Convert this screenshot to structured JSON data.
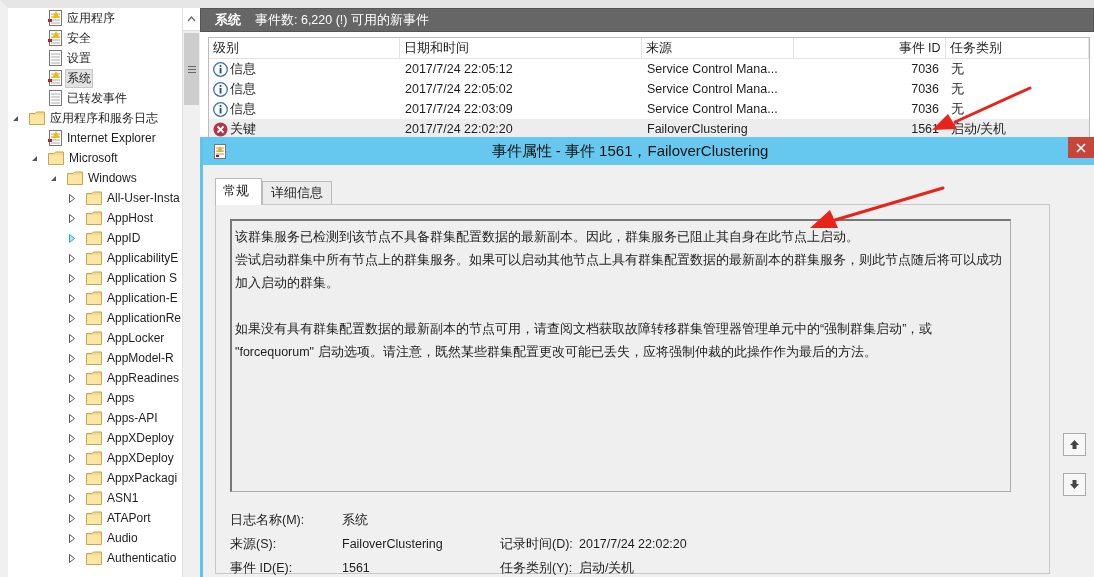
{
  "sidebar": {
    "visible_children": [
      {
        "label": "应用程序",
        "kind": "log-warn",
        "selected": false
      },
      {
        "label": "安全",
        "kind": "log-warn",
        "selected": false
      },
      {
        "label": "设置",
        "kind": "log",
        "selected": false
      },
      {
        "label": "系统",
        "kind": "log-warn",
        "selected": true
      },
      {
        "label": "已转发事件",
        "kind": "log",
        "selected": false
      }
    ],
    "items": [
      {
        "label": "应用程序和服务日志",
        "kind": "folder",
        "selected": false,
        "expanded": true,
        "hovered": false,
        "children": [
          {
            "label": "Internet Explorer",
            "kind": "log-warn",
            "selected": false
          },
          {
            "label": "Microsoft",
            "kind": "folder",
            "selected": false,
            "expanded": true,
            "hovered": false,
            "children": [
              {
                "label": "Windows",
                "kind": "folder",
                "selected": false,
                "expanded": true,
                "hovered": false,
                "children": [
                  {
                    "label": "All-User-Insta",
                    "kind": "folder",
                    "selected": false,
                    "expanded": false,
                    "hovered": false
                  },
                  {
                    "label": "AppHost",
                    "kind": "folder",
                    "selected": false,
                    "expanded": false,
                    "hovered": false
                  },
                  {
                    "label": "AppID",
                    "kind": "folder",
                    "selected": false,
                    "expanded": false,
                    "hovered": true
                  },
                  {
                    "label": "ApplicabilityE",
                    "kind": "folder",
                    "selected": false,
                    "expanded": false,
                    "hovered": false
                  },
                  {
                    "label": "Application S",
                    "kind": "folder",
                    "selected": false,
                    "expanded": false,
                    "hovered": false
                  },
                  {
                    "label": "Application-E",
                    "kind": "folder",
                    "selected": false,
                    "expanded": false,
                    "hovered": false
                  },
                  {
                    "label": "ApplicationRe",
                    "kind": "folder",
                    "selected": false,
                    "expanded": false,
                    "hovered": false
                  },
                  {
                    "label": "AppLocker",
                    "kind": "folder",
                    "selected": false,
                    "expanded": false,
                    "hovered": false
                  },
                  {
                    "label": "AppModel-R",
                    "kind": "folder",
                    "selected": false,
                    "expanded": false,
                    "hovered": false
                  },
                  {
                    "label": "AppReadines",
                    "kind": "folder",
                    "selected": false,
                    "expanded": false,
                    "hovered": false
                  },
                  {
                    "label": "Apps",
                    "kind": "folder",
                    "selected": false,
                    "expanded": false,
                    "hovered": false
                  },
                  {
                    "label": "Apps-API",
                    "kind": "folder",
                    "selected": false,
                    "expanded": false,
                    "hovered": false
                  },
                  {
                    "label": "AppXDeploy",
                    "kind": "folder",
                    "selected": false,
                    "expanded": false,
                    "hovered": false
                  },
                  {
                    "label": "AppXDeploy",
                    "kind": "folder",
                    "selected": false,
                    "expanded": false,
                    "hovered": false
                  },
                  {
                    "label": "AppxPackagi",
                    "kind": "folder",
                    "selected": false,
                    "expanded": false,
                    "hovered": false
                  },
                  {
                    "label": "ASN1",
                    "kind": "folder",
                    "selected": false,
                    "expanded": false,
                    "hovered": false
                  },
                  {
                    "label": "ATAPort",
                    "kind": "folder",
                    "selected": false,
                    "expanded": false,
                    "hovered": false
                  },
                  {
                    "label": "Audio",
                    "kind": "folder",
                    "selected": false,
                    "expanded": false,
                    "hovered": false
                  },
                  {
                    "label": "Authenticatio",
                    "kind": "folder",
                    "selected": false,
                    "expanded": false,
                    "hovered": false
                  }
                ]
              }
            ]
          }
        ]
      }
    ]
  },
  "log_header": {
    "title": "系统",
    "summary": "事件数: 6,220 (!) 可用的新事件"
  },
  "table": {
    "columns": [
      "级别",
      "日期和时间",
      "来源",
      "事件 ID",
      "任务类别"
    ],
    "rows": [
      {
        "kind": "info",
        "level": "信息",
        "date": "2017/7/24 22:05:12",
        "source": "Service Control Mana...",
        "event_id": "7036",
        "category": "无",
        "selected": false
      },
      {
        "kind": "info",
        "level": "信息",
        "date": "2017/7/24 22:05:02",
        "source": "Service Control Mana...",
        "event_id": "7036",
        "category": "无",
        "selected": false
      },
      {
        "kind": "info",
        "level": "信息",
        "date": "2017/7/24 22:03:09",
        "source": "Service Control Mana...",
        "event_id": "7036",
        "category": "无",
        "selected": false
      },
      {
        "kind": "critical",
        "level": "关键",
        "date": "2017/7/24 22:02:20",
        "source": "FailoverClustering",
        "event_id": "1561",
        "category": "启动/关机",
        "selected": true
      }
    ]
  },
  "dialog": {
    "title": "事件属性 - 事件 1561，FailoverClustering",
    "tabs": [
      {
        "label": "常规",
        "selected": true
      },
      {
        "label": "详细信息",
        "selected": false
      }
    ],
    "description": [
      [
        "该群集服务已检测到该节点不具备群集配置数据的最新副本。因此，群集服务已阻止其自身在此节点上启动。",
        "尝试启动群集中所有节点上的群集服务。如果可以启动其他节点上具有群集配置数据的最新副本的群集服务，则此节点随后将可以成功加入启动的群集。"
      ],
      [
        "如果没有具有群集配置数据的最新副本的节点可用，请查阅文档获取故障转移群集管理器管理单元中的“强制群集启动”，或 \"forcequorum\" 启动选项。请注意，既然某些群集配置更改可能已丢失，应将强制仲裁的此操作作为最后的方法。"
      ]
    ],
    "fields": [
      [
        {
          "label": "日志名称(M):",
          "value": "系统"
        }
      ],
      [
        {
          "label": "来源(S):",
          "value": "FailoverClustering"
        },
        {
          "label": "记录时间(D):",
          "value": "2017/7/24 22:02:20"
        }
      ],
      [
        {
          "label": "事件 ID(E):",
          "value": "1561"
        },
        {
          "label": "任务类别(Y):",
          "value": "启动/关机"
        }
      ]
    ]
  }
}
